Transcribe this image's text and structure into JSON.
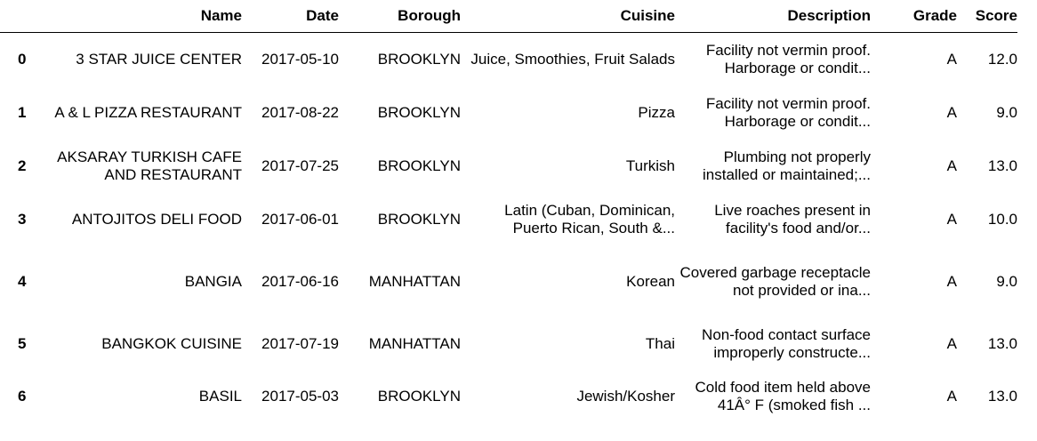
{
  "table": {
    "columns": [
      "",
      "Name",
      "Date",
      "Borough",
      "Cuisine",
      "Description",
      "Grade",
      "Score"
    ],
    "rows": [
      {
        "index": "0",
        "name": "3 STAR JUICE CENTER",
        "date": "2017-05-10",
        "borough": "BROOKLYN",
        "cuisine": "Juice, Smoothies, Fruit Salads",
        "description": "Facility not vermin proof. Harborage or condit...",
        "grade": "A",
        "score": "12.0"
      },
      {
        "index": "1",
        "name": "A & L PIZZA RESTAURANT",
        "date": "2017-08-22",
        "borough": "BROOKLYN",
        "cuisine": "Pizza",
        "description": "Facility not vermin proof. Harborage or condit...",
        "grade": "A",
        "score": "9.0"
      },
      {
        "index": "2",
        "name": "AKSARAY TURKISH CAFE AND RESTAURANT",
        "date": "2017-07-25",
        "borough": "BROOKLYN",
        "cuisine": "Turkish",
        "description": "Plumbing not properly installed or maintained;...",
        "grade": "A",
        "score": "13.0"
      },
      {
        "index": "3",
        "name": "ANTOJITOS DELI FOOD",
        "date": "2017-06-01",
        "borough": "BROOKLYN",
        "cuisine": "Latin (Cuban, Dominican, Puerto Rican, South &...",
        "description": "Live roaches present in facility's food and/or...",
        "grade": "A",
        "score": "10.0"
      },
      {
        "index": "4",
        "name": "BANGIA",
        "date": "2017-06-16",
        "borough": "MANHATTAN",
        "cuisine": "Korean",
        "description": "Covered garbage receptacle not provided or ina...",
        "grade": "A",
        "score": "9.0"
      },
      {
        "index": "5",
        "name": "BANGKOK CUISINE",
        "date": "2017-07-19",
        "borough": "MANHATTAN",
        "cuisine": "Thai",
        "description": "Non-food contact surface improperly constructe...",
        "grade": "A",
        "score": "13.0"
      },
      {
        "index": "6",
        "name": "BASIL",
        "date": "2017-05-03",
        "borough": "BROOKLYN",
        "cuisine": "Jewish/Kosher",
        "description": "Cold food item held above 41Â° F (smoked fish ...",
        "grade": "A",
        "score": "13.0"
      }
    ]
  }
}
